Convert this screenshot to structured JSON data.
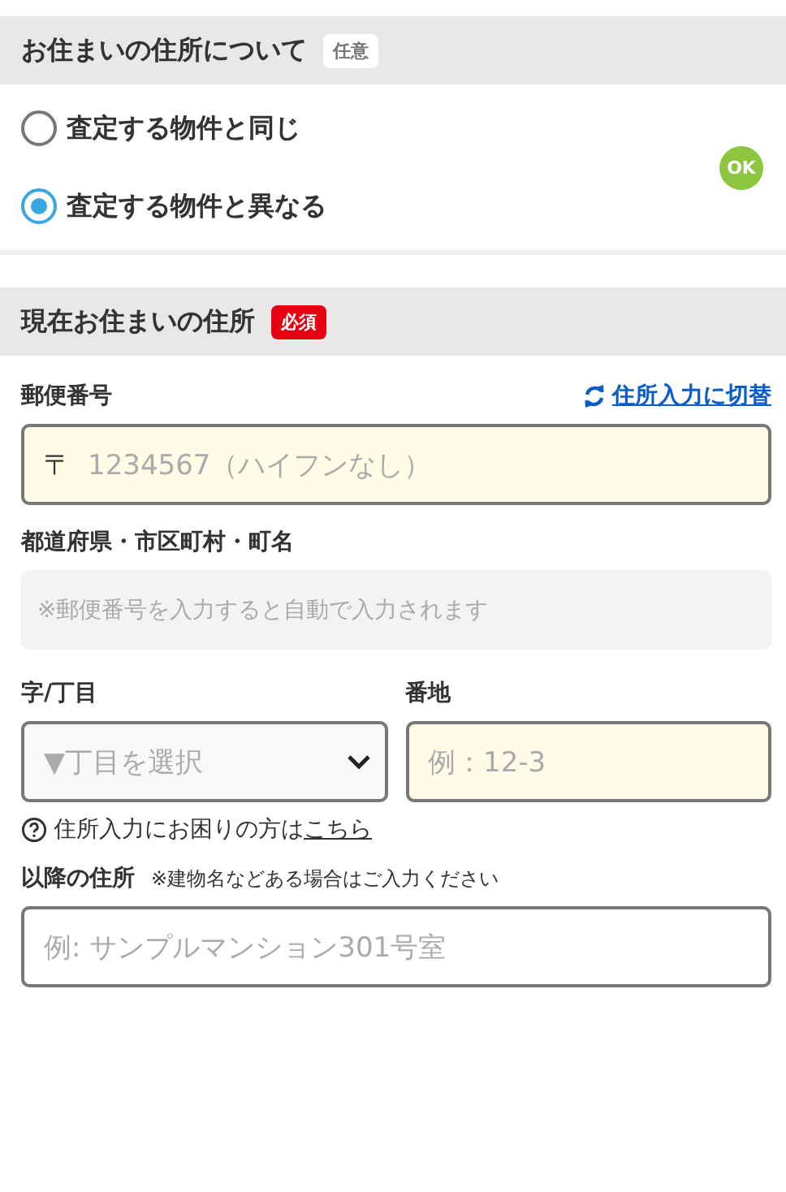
{
  "residence": {
    "title": "お住まいの住所について",
    "badge": {
      "text": "任意",
      "kind": "optional"
    },
    "options": [
      {
        "label": "査定する物件と同じ",
        "selected": false
      },
      {
        "label": "査定する物件と異なる",
        "selected": true
      }
    ],
    "status": "OK"
  },
  "current_address": {
    "title": "現在お住まいの住所",
    "badge": {
      "text": "必須",
      "kind": "required"
    },
    "postal": {
      "label": "郵便番号",
      "switch_link": "住所入力に切替",
      "prefix": "〒",
      "placeholder": "1234567（ハイフンなし）"
    },
    "region": {
      "label": "都道府県・市区町村・町名",
      "placeholder": "※郵便番号を入力すると自動で入力されます"
    },
    "chome": {
      "label": "字/丁目",
      "placeholder": "▼丁目を選択"
    },
    "banchi": {
      "label": "番地",
      "placeholder": "例：12-3"
    },
    "help": {
      "text": "住所入力にお困りの方は",
      "link": "こちら"
    },
    "rest": {
      "label": "以降の住所",
      "note": "※建物名などある場合はご入力ください",
      "placeholder": "例: サンプルマンション301号室"
    }
  }
}
